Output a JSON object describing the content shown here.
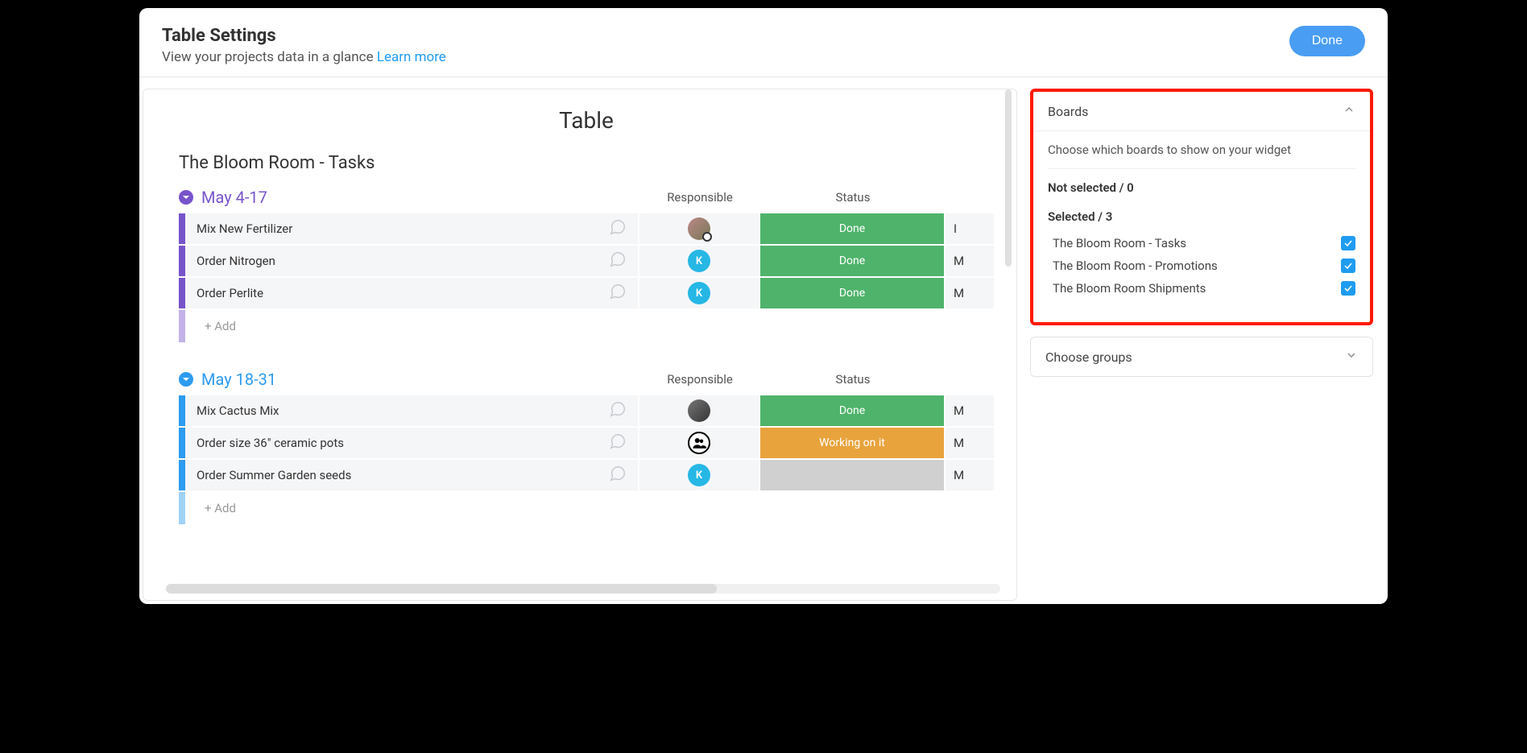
{
  "header": {
    "title": "Table Settings",
    "subtitle_prefix": "View your projects data in a glance ",
    "learn_more": "Learn more",
    "done_label": "Done"
  },
  "main": {
    "title": "Table",
    "board_name": "The Bloom Room - Tasks",
    "columns": {
      "responsible": "Responsible",
      "status": "Status"
    },
    "add_label": "+ Add",
    "groups": [
      {
        "name": "May 4-17",
        "color": "purple",
        "rows": [
          {
            "name": "Mix New Fertilizer",
            "avatar": {
              "kind": "photo",
              "label": ""
            },
            "avatarBadge": "-",
            "status": "Done",
            "statusClass": "done",
            "extra": "I"
          },
          {
            "name": "Order Nitrogen",
            "avatar": {
              "kind": "letter",
              "label": "K"
            },
            "status": "Done",
            "statusClass": "done",
            "extra": "M"
          },
          {
            "name": "Order Perlite",
            "avatar": {
              "kind": "letter",
              "label": "K"
            },
            "status": "Done",
            "statusClass": "done",
            "extra": "M"
          }
        ]
      },
      {
        "name": "May 18-31",
        "color": "blue",
        "rows": [
          {
            "name": "Mix Cactus Mix",
            "avatar": {
              "kind": "photo2",
              "label": ""
            },
            "status": "Done",
            "statusClass": "done",
            "extra": "M"
          },
          {
            "name": "Order size 36\" ceramic pots",
            "avatar": {
              "kind": "multi",
              "label": ""
            },
            "status": "Working on it",
            "statusClass": "working",
            "extra": "M"
          },
          {
            "name": "Order Summer Garden seeds",
            "avatar": {
              "kind": "letter",
              "label": "K"
            },
            "status": "",
            "statusClass": "empty",
            "extra": "M"
          }
        ]
      }
    ]
  },
  "sidebar": {
    "boards_panel": {
      "title": "Boards",
      "description": "Choose which boards to show on your widget",
      "not_selected_label": "Not selected / 0",
      "selected_label": "Selected / 3",
      "items": [
        {
          "label": "The Bloom Room - Tasks",
          "checked": true
        },
        {
          "label": "The Bloom Room - Promotions",
          "checked": true
        },
        {
          "label": "The Bloom Room Shipments",
          "checked": true
        }
      ]
    },
    "groups_panel": {
      "title": "Choose groups"
    }
  }
}
